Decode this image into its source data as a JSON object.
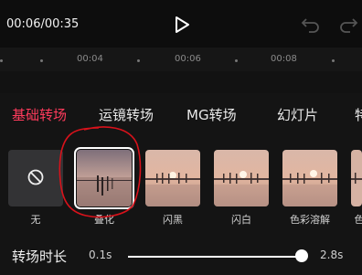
{
  "player": {
    "time": "00:06/00:35"
  },
  "ruler": {
    "ticks": [
      "00:04",
      "00:06",
      "00:08"
    ]
  },
  "tabs": [
    {
      "label": "基础转场",
      "active": true
    },
    {
      "label": "运镜转场",
      "active": false
    },
    {
      "label": "MG转场",
      "active": false
    },
    {
      "label": "幻灯片",
      "active": false
    },
    {
      "label": "特",
      "active": false
    }
  ],
  "transitions": [
    {
      "label": "无",
      "icon": "none-icon"
    },
    {
      "label": "叠化",
      "selected": true
    },
    {
      "label": "闪黑"
    },
    {
      "label": "闪白"
    },
    {
      "label": "色彩溶解"
    },
    {
      "label": "色"
    }
  ],
  "duration": {
    "label": "转场时长",
    "min": "0.1s",
    "max": "2.8s",
    "value_fraction": 1.0
  },
  "colors": {
    "accent": "#ff3b5c",
    "annotation": "#d8121b"
  }
}
